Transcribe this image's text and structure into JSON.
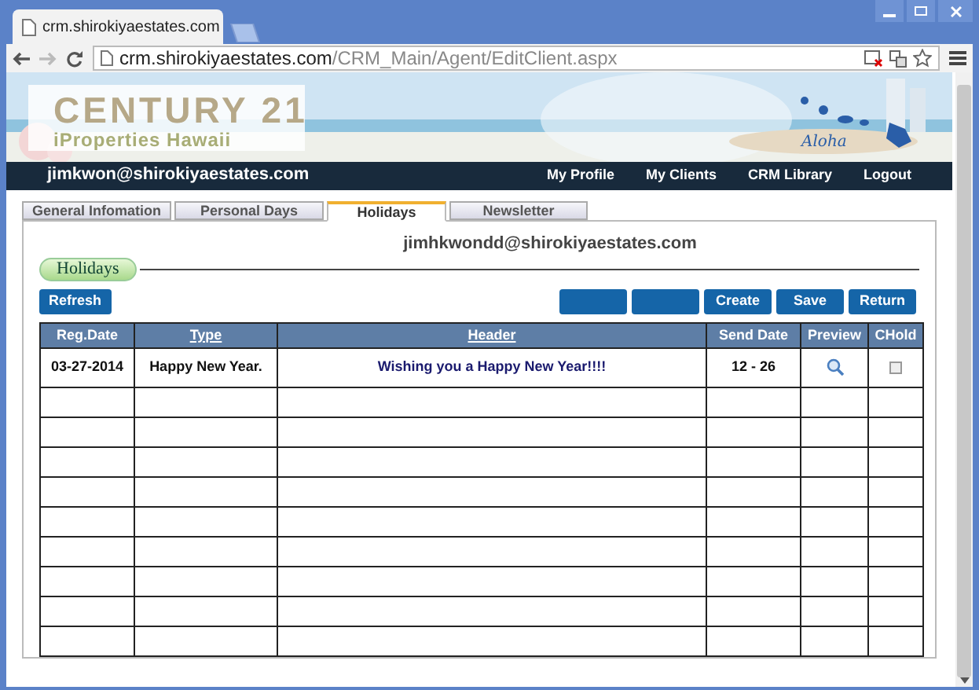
{
  "browser": {
    "tab_title": "crm.shirokiyaestates.com",
    "url": {
      "host": "crm.shirokiyaestates.com",
      "path": "/CRM_Main/Agent/EditClient.aspx"
    }
  },
  "banner": {
    "brand": "CENTURY 21",
    "subtitle": "iProperties Hawaii",
    "script_text": "Aloha"
  },
  "navbar": {
    "user": "jimkwon@shirokiyaestates.com",
    "links": [
      "My Profile",
      "My Clients",
      "CRM Library",
      "Logout"
    ]
  },
  "tabs": [
    {
      "label": "General Infomation",
      "selected": false
    },
    {
      "label": "Personal Days",
      "selected": false
    },
    {
      "label": "Holidays",
      "selected": true
    },
    {
      "label": "Newsletter",
      "selected": false
    }
  ],
  "client_email": "jimhkwondd@shirokiyaestates.com",
  "section_title": "Holidays",
  "refresh_button": "Refresh",
  "action_buttons": [
    {
      "kind": "blank"
    },
    {
      "kind": "blank"
    },
    {
      "kind": "labeled",
      "label": "Create"
    },
    {
      "kind": "labeled",
      "label": "Save"
    },
    {
      "kind": "labeled",
      "label": "Return"
    }
  ],
  "table": {
    "columns": [
      {
        "label": "Reg.Date",
        "link": false
      },
      {
        "label": "Type",
        "link": true
      },
      {
        "label": "Header",
        "link": true
      },
      {
        "label": "Send Date",
        "link": false
      },
      {
        "label": "Preview",
        "link": false
      },
      {
        "label": "CHold",
        "link": false
      }
    ],
    "rows": [
      {
        "reg_date": "03-27-2014",
        "type": "Happy New Year.",
        "header": "Wishing you a Happy New Year!!!!",
        "send_date": "12 - 26",
        "checked": false
      }
    ]
  }
}
